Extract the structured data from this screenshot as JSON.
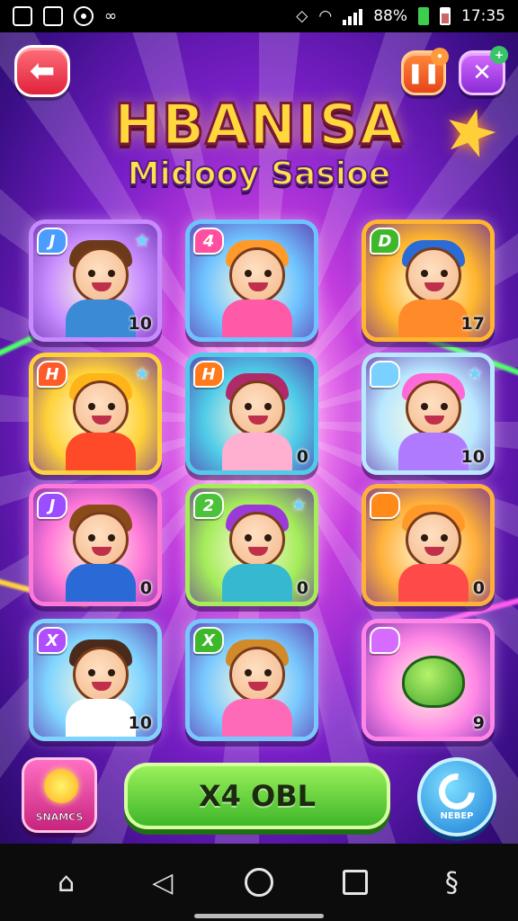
{
  "status_bar": {
    "battery_text": "88%",
    "time": "17:35",
    "icons_left": [
      "notification-square-icon",
      "image-icon",
      "record-circle-icon",
      "link-icon"
    ],
    "icons_right": [
      "cast-icon",
      "wifi-icon",
      "signal-icon",
      "battery-icon"
    ]
  },
  "header": {
    "back_icon": "arrow-left-icon",
    "pause_icon": "pause-icon",
    "close_icon": "close-x-icon",
    "title": "HBANISA",
    "subtitle": "Midooy Sasioe"
  },
  "cards": [
    {
      "badge": "J",
      "badge_color": "#4a9cff",
      "value": "10",
      "theme": "#c78bff",
      "star": true
    },
    {
      "badge": "4",
      "badge_color": "#ff4fa0",
      "value": "",
      "theme": "#6ec3ff",
      "star": false
    },
    {
      "badge": "D",
      "badge_color": "#3fb72a",
      "value": "17",
      "theme": "#ffb52e",
      "star": false
    },
    {
      "badge": "H",
      "badge_color": "#ff5a2a",
      "value": "",
      "theme": "#ffd23a",
      "star": true
    },
    {
      "badge": "H",
      "badge_color": "#ff7a1a",
      "value": "0",
      "theme": "#4ecbe8",
      "star": false
    },
    {
      "badge": "",
      "badge_color": "#7ad0ff",
      "value": "10",
      "theme": "#b8e8ff",
      "star": true
    },
    {
      "badge": "J",
      "badge_color": "#9b4dff",
      "value": "0",
      "theme": "#ff78d8",
      "star": false
    },
    {
      "badge": "2",
      "badge_color": "#4cc23a",
      "value": "0",
      "theme": "#a4ec5a",
      "star": true
    },
    {
      "badge": "",
      "badge_color": "#ff8a1a",
      "value": "0",
      "theme": "#ffb03a",
      "star": false
    },
    {
      "badge": "X",
      "badge_color": "#b04dff",
      "value": "10",
      "theme": "#7fd4ff",
      "star": false
    },
    {
      "badge": "X",
      "badge_color": "#3fb72a",
      "value": "",
      "theme": "#78c8ff",
      "star": false
    },
    {
      "badge": "",
      "badge_color": "#d66cff",
      "value": "9",
      "theme": "#ff86e6",
      "star": false
    }
  ],
  "bottom": {
    "left_label": "SNAMCS",
    "play_label": "X4 OBL",
    "right_label": "NEBEP"
  },
  "nav": {
    "icons": [
      "home-icon",
      "back-triangle-icon",
      "home-circle-icon",
      "recents-square-icon",
      "assistant-icon"
    ]
  },
  "colors": {
    "bg_center": "#ff9cf5",
    "bg_edge": "#2a0a66",
    "play_green": "#3fb72a",
    "title_yellow": "#ffd93b"
  }
}
